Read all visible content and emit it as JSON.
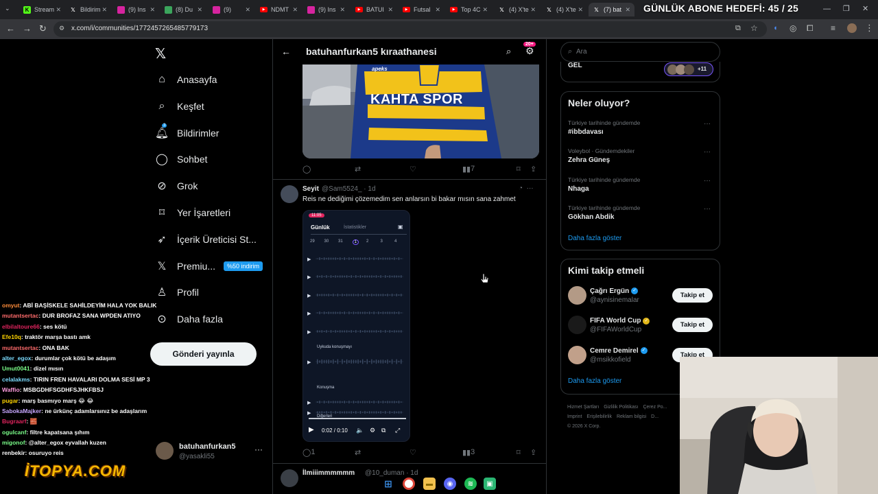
{
  "browser": {
    "tabs": [
      {
        "label": "Stream",
        "icon": "kick-icon",
        "color": "#53fc18"
      },
      {
        "label": "Bildirim",
        "icon": "x-icon",
        "color": "#000000"
      },
      {
        "label": "(9) Ins",
        "icon": "instagram-icon",
        "color": "#d6249f"
      },
      {
        "label": "(8) Du",
        "icon": "discord-like-icon",
        "color": "#3ba55c"
      },
      {
        "label": "(9)",
        "icon": "instagram-icon",
        "color": "#d6249f"
      },
      {
        "label": "NDMT",
        "icon": "youtube-icon",
        "color": "#ff0000"
      },
      {
        "label": "(9) Ins",
        "icon": "instagram-icon",
        "color": "#d6249f"
      },
      {
        "label": "BATUI",
        "icon": "youtube-icon",
        "color": "#ff0000"
      },
      {
        "label": "Futsal",
        "icon": "youtube-icon",
        "color": "#ff0000"
      },
      {
        "label": "Top 4C",
        "icon": "youtube-icon",
        "color": "#ff0000"
      },
      {
        "label": "(4) X'te",
        "icon": "x-icon",
        "color": "#000000"
      },
      {
        "label": "(4) X'te",
        "icon": "x-icon",
        "color": "#000000"
      },
      {
        "label": "(7) bat",
        "icon": "x-icon",
        "color": "#000000"
      }
    ],
    "url": "x.com/i/communities/1772457265485779173",
    "overlay_title": "GÜNLÜK ABONE HEDEFİ: 45 / 25"
  },
  "sidebar": {
    "items": [
      {
        "label": "Anasayfa",
        "icon": "home-icon"
      },
      {
        "label": "Keşfet",
        "icon": "search-icon"
      },
      {
        "label": "Bildirimler",
        "icon": "bell-icon",
        "badge": "3"
      },
      {
        "label": "Sohbet",
        "icon": "chat-icon"
      },
      {
        "label": "Grok",
        "icon": "grok-icon"
      },
      {
        "label": "Yer İşaretleri",
        "icon": "bookmark-icon"
      },
      {
        "label": "İçerik Üreticisi St...",
        "icon": "rocket-icon"
      },
      {
        "label": "Premiu...",
        "icon": "x-icon",
        "badge_text": "%50 indirim"
      },
      {
        "label": "Profil",
        "icon": "person-icon"
      },
      {
        "label": "Daha fazla",
        "icon": "more-circle-icon"
      }
    ],
    "post_button": "Gönderi yayınla",
    "account": {
      "name": "batuhanfurkan5",
      "handle": "@yasakli55"
    }
  },
  "chat": [
    {
      "user": "omyut",
      "msg": ": ABİ BAŞİSKELE SAHİLDEYİM HALA YOK BALIK",
      "color": "#ff8c3a"
    },
    {
      "user": "mutantsertac",
      "msg": ": DUR BROFAZ SANA WPDEN ATIYO",
      "color": "#ff6b6b"
    },
    {
      "user": "elbilaltoure66",
      "msg": ": ses kötü",
      "color": "#e0245e"
    },
    {
      "user": "Efe10q",
      "msg": ": traktör marşa bastı amk",
      "color": "#ffd400"
    },
    {
      "user": "mutantsertac",
      "msg": ": ONA BAK",
      "color": "#ff6b6b"
    },
    {
      "user": "alter_egox",
      "msg": ": durumlar çok kötü be adaşım",
      "color": "#7bdcff"
    },
    {
      "user": "Umut0041",
      "msg": ": dizel mısın",
      "color": "#7bff8a"
    },
    {
      "user": "celalakms",
      "msg": ": TIRIN FREN HAVALARI DOLMA SESİ MP 3",
      "color": "#7bdcff"
    },
    {
      "user": "Waffio",
      "msg": ": MSBGDHFSGDHFSJHKFBSJ",
      "color": "#ff9de0"
    },
    {
      "user": "pugar",
      "msg": ": marş basmıyo marş 😂 😂",
      "color": "#ffd400"
    },
    {
      "user": "SabokaMajker",
      "msg": ": ne ürkünç adamlarsınız be adaşlarım",
      "color": "#c7a7ff"
    },
    {
      "user": "Bugraarf",
      "msg": ": 🧱",
      "color": "#e0245e"
    },
    {
      "user": "oguIcanf",
      "msg": ": filtre kapatsana şıhım",
      "color": "#7bff8a"
    },
    {
      "user": "migonof",
      "msg": ": @alter_egox eyvallah kuzen",
      "color": "#7bff8a"
    },
    {
      "user": "renbekir",
      "msg": ": osuruyo reis",
      "color": "#ffffff"
    }
  ],
  "brand_overlay": "İTOPYA.COM",
  "community": {
    "title": "batuhanfurkan5 kıraathanesi",
    "notif_badge": "20+",
    "tweet1": {
      "jersey_text": "KAHTA SPOR",
      "sponsor": "apeks",
      "views": "7"
    },
    "tweet2": {
      "name": "Seyit",
      "handle": "@Sam5524_ · 1d",
      "text": "Reis ne dediğimi çözemedim sen anlarsın bi bakar mısın sana zahmet",
      "video": {
        "app_time": "11:05",
        "tab_active": "Günlük",
        "tab_other": "İstatistikler",
        "dates": [
          "29",
          "30",
          "31",
          "1",
          "2",
          "3",
          "4"
        ],
        "section1": "Uykuda konuşmayı",
        "section2": "Konuşma",
        "section3": "Diğerleri",
        "time": "0:02 / 0:10"
      },
      "replies": "1",
      "views": "3"
    },
    "tweet3": {
      "name": "İlmiiimmmmmm",
      "handle": "@10_duman · 1d"
    }
  },
  "right": {
    "search_placeholder": "Ara",
    "community_card": {
      "label": "GEL",
      "count": "+11"
    },
    "trends_title": "Neler oluyor?",
    "trends": [
      {
        "category": "Türkiye tarihinde gündemde",
        "name": "#ibbdavası"
      },
      {
        "category": "Voleybol · Gündemdekiler",
        "name": "Zehra Güneş"
      },
      {
        "category": "Türkiye tarihinde gündemde",
        "name": "Nhaga"
      },
      {
        "category": "Türkiye tarihinde gündemde",
        "name": "Gökhan Abdik"
      }
    ],
    "show_more": "Daha fazla göster",
    "who_title": "Kimi takip etmeli",
    "who": [
      {
        "name": "Çağrı Ergün",
        "handle": "@aynisinemalar",
        "badge": "#1d9bf0"
      },
      {
        "name": "FIFA World Cup",
        "handle": "@FIFAWorldCup",
        "badge": "#e2b719"
      },
      {
        "name": "Cemre Demirel",
        "handle": "@msikkofield",
        "badge": "#1d9bf0"
      }
    ],
    "follow_label": "Takip et",
    "footer": [
      "Hizmet Şartları",
      "Gizlilik Politikası",
      "Çerez Po...",
      "Imprint",
      "Erişilebilirlik",
      "Reklam bilgisi",
      "D...",
      "© 2026 X Corp."
    ]
  }
}
